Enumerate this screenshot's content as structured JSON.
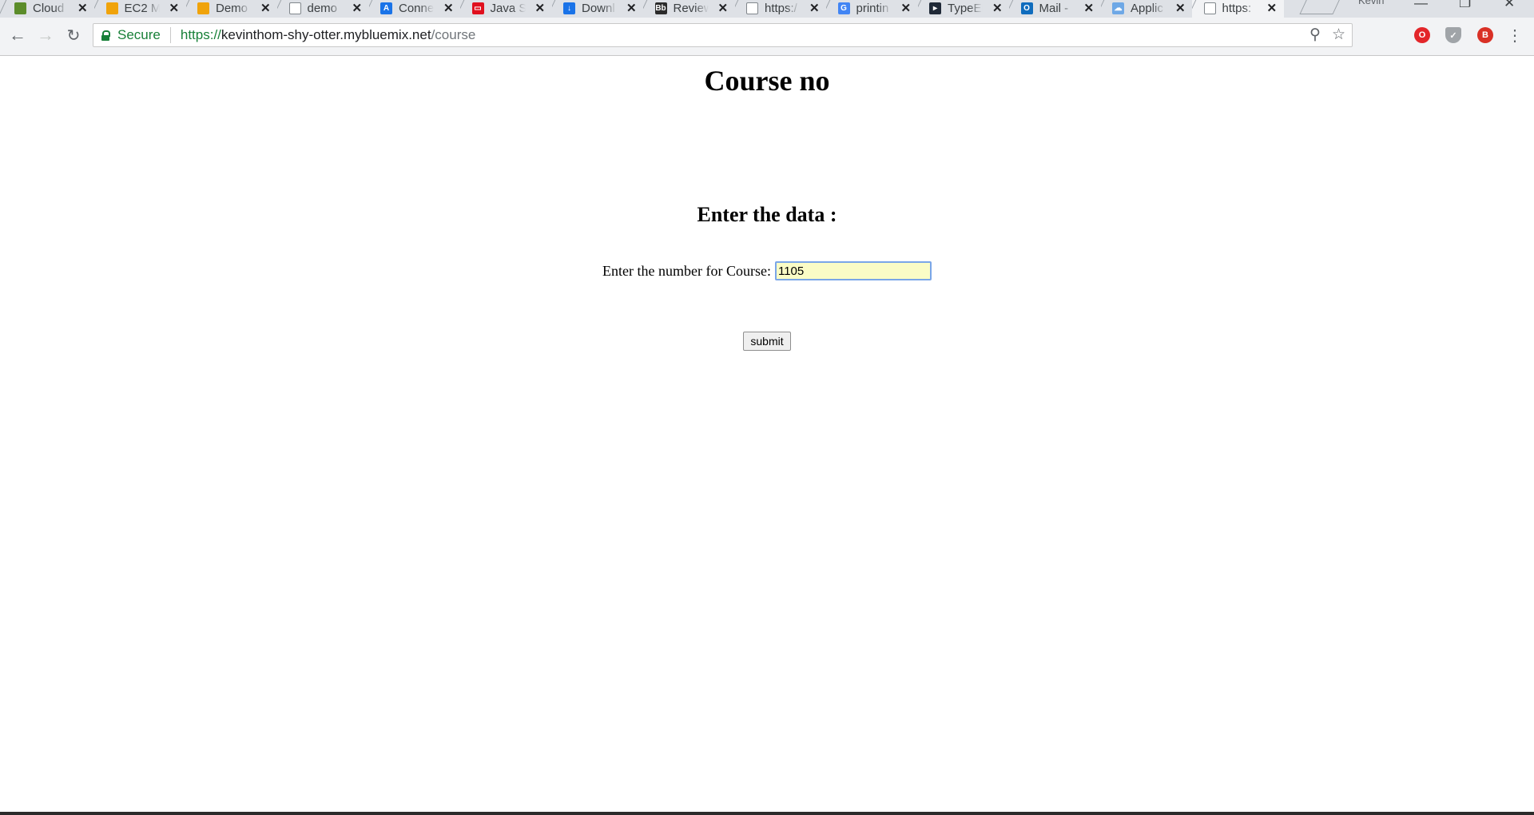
{
  "browser": {
    "tabs": [
      {
        "title": "Cloud",
        "icon": "cloud-foundry-icon",
        "color": "#5b8c2a"
      },
      {
        "title": "EC2 M",
        "icon": "aws-box-icon",
        "color": "#f0a30a"
      },
      {
        "title": "Demo",
        "icon": "aws-box-icon",
        "color": "#f0a30a"
      },
      {
        "title": "demo",
        "icon": "document-icon",
        "color": "#ffffff"
      },
      {
        "title": "Conne",
        "icon": "azure-icon",
        "color": "#1a73e8"
      },
      {
        "title": "Java S",
        "icon": "oracle-icon",
        "color": "#e0101e"
      },
      {
        "title": "Downl",
        "icon": "download-icon",
        "color": "#1a73e8"
      },
      {
        "title": "Review",
        "icon": "blackboard-icon",
        "color": "#2b2b2b"
      },
      {
        "title": "https:/",
        "icon": "document-icon",
        "color": "#ffffff"
      },
      {
        "title": "printin",
        "icon": "google-icon",
        "color": "#4285f4"
      },
      {
        "title": "TypeEr",
        "icon": "terminal-icon",
        "color": "#1f2937"
      },
      {
        "title": "Mail -",
        "icon": "outlook-icon",
        "color": "#0f6cbd"
      },
      {
        "title": "Applic",
        "icon": "ibm-cloud-icon",
        "color": "#6ea8e6"
      },
      {
        "title": "https:",
        "icon": "document-icon",
        "color": "#ffffff"
      }
    ],
    "profile_name": "Kevin",
    "toolbar": {
      "secure_label": "Secure",
      "url_scheme": "https://",
      "url_host": "kevinthom-shy-otter.mybluemix.net",
      "url_path": "/course"
    }
  },
  "page": {
    "title": "Course no",
    "subtitle": "Enter the data :",
    "course_label": "Enter the number for Course:",
    "course_value": "1105",
    "submit_label": "submit"
  }
}
